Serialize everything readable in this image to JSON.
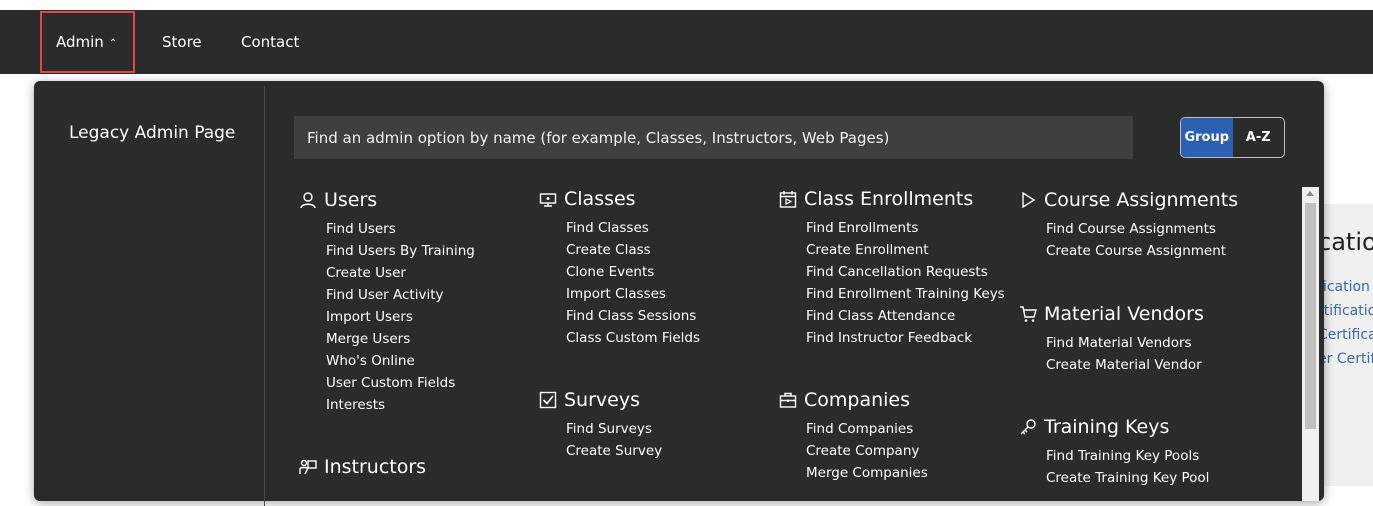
{
  "nav": {
    "items": [
      {
        "label": "Admin"
      },
      {
        "label": "Store"
      },
      {
        "label": "Contact"
      }
    ]
  },
  "background": {
    "title": "catio",
    "links": [
      "fication",
      "rtification",
      "Certifica",
      "er Certif"
    ]
  },
  "menu": {
    "legacy_label": "Legacy Admin Page",
    "search": {
      "placeholder": "Find an admin option by name (for example, Classes, Instructors, Web Pages)",
      "value": ""
    },
    "toggle": {
      "group": "Group",
      "az": "A-Z",
      "selected": "Group"
    },
    "accent_color": "#2d5fb3",
    "groups": [
      {
        "title": "Users",
        "icon": "user-icon",
        "items": [
          "Find Users",
          "Find Users By Training",
          "Create User",
          "Find User Activity",
          "Import Users",
          "Merge Users",
          "Who's Online",
          "User Custom Fields",
          "Interests"
        ]
      },
      {
        "title": "Instructors",
        "icon": "instructor-icon",
        "items": []
      },
      {
        "title": "Classes",
        "icon": "classroom-icon",
        "items": [
          "Find Classes",
          "Create Class",
          "Clone Events",
          "Import Classes",
          "Find Class Sessions",
          "Class Custom Fields"
        ]
      },
      {
        "title": "Surveys",
        "icon": "checkbox-icon",
        "items": [
          "Find Surveys",
          "Create Survey"
        ]
      },
      {
        "title": "Class Enrollments",
        "icon": "calendar-icon",
        "items": [
          "Find Enrollments",
          "Create Enrollment",
          "Find Cancellation Requests",
          "Find Enrollment Training Keys",
          "Find Class Attendance",
          "Find Instructor Feedback"
        ]
      },
      {
        "title": "Companies",
        "icon": "briefcase-icon",
        "items": [
          "Find Companies",
          "Create Company",
          "Merge Companies"
        ]
      },
      {
        "title": "Course Assignments",
        "icon": "play-icon",
        "items": [
          "Find Course Assignments",
          "Create Course Assignment"
        ]
      },
      {
        "title": "Material Vendors",
        "icon": "cart-icon",
        "items": [
          "Find Material Vendors",
          "Create Material Vendor"
        ]
      },
      {
        "title": "Training Keys",
        "icon": "key-icon",
        "items": [
          "Find Training Key Pools",
          "Create Training Key Pool"
        ]
      }
    ]
  }
}
